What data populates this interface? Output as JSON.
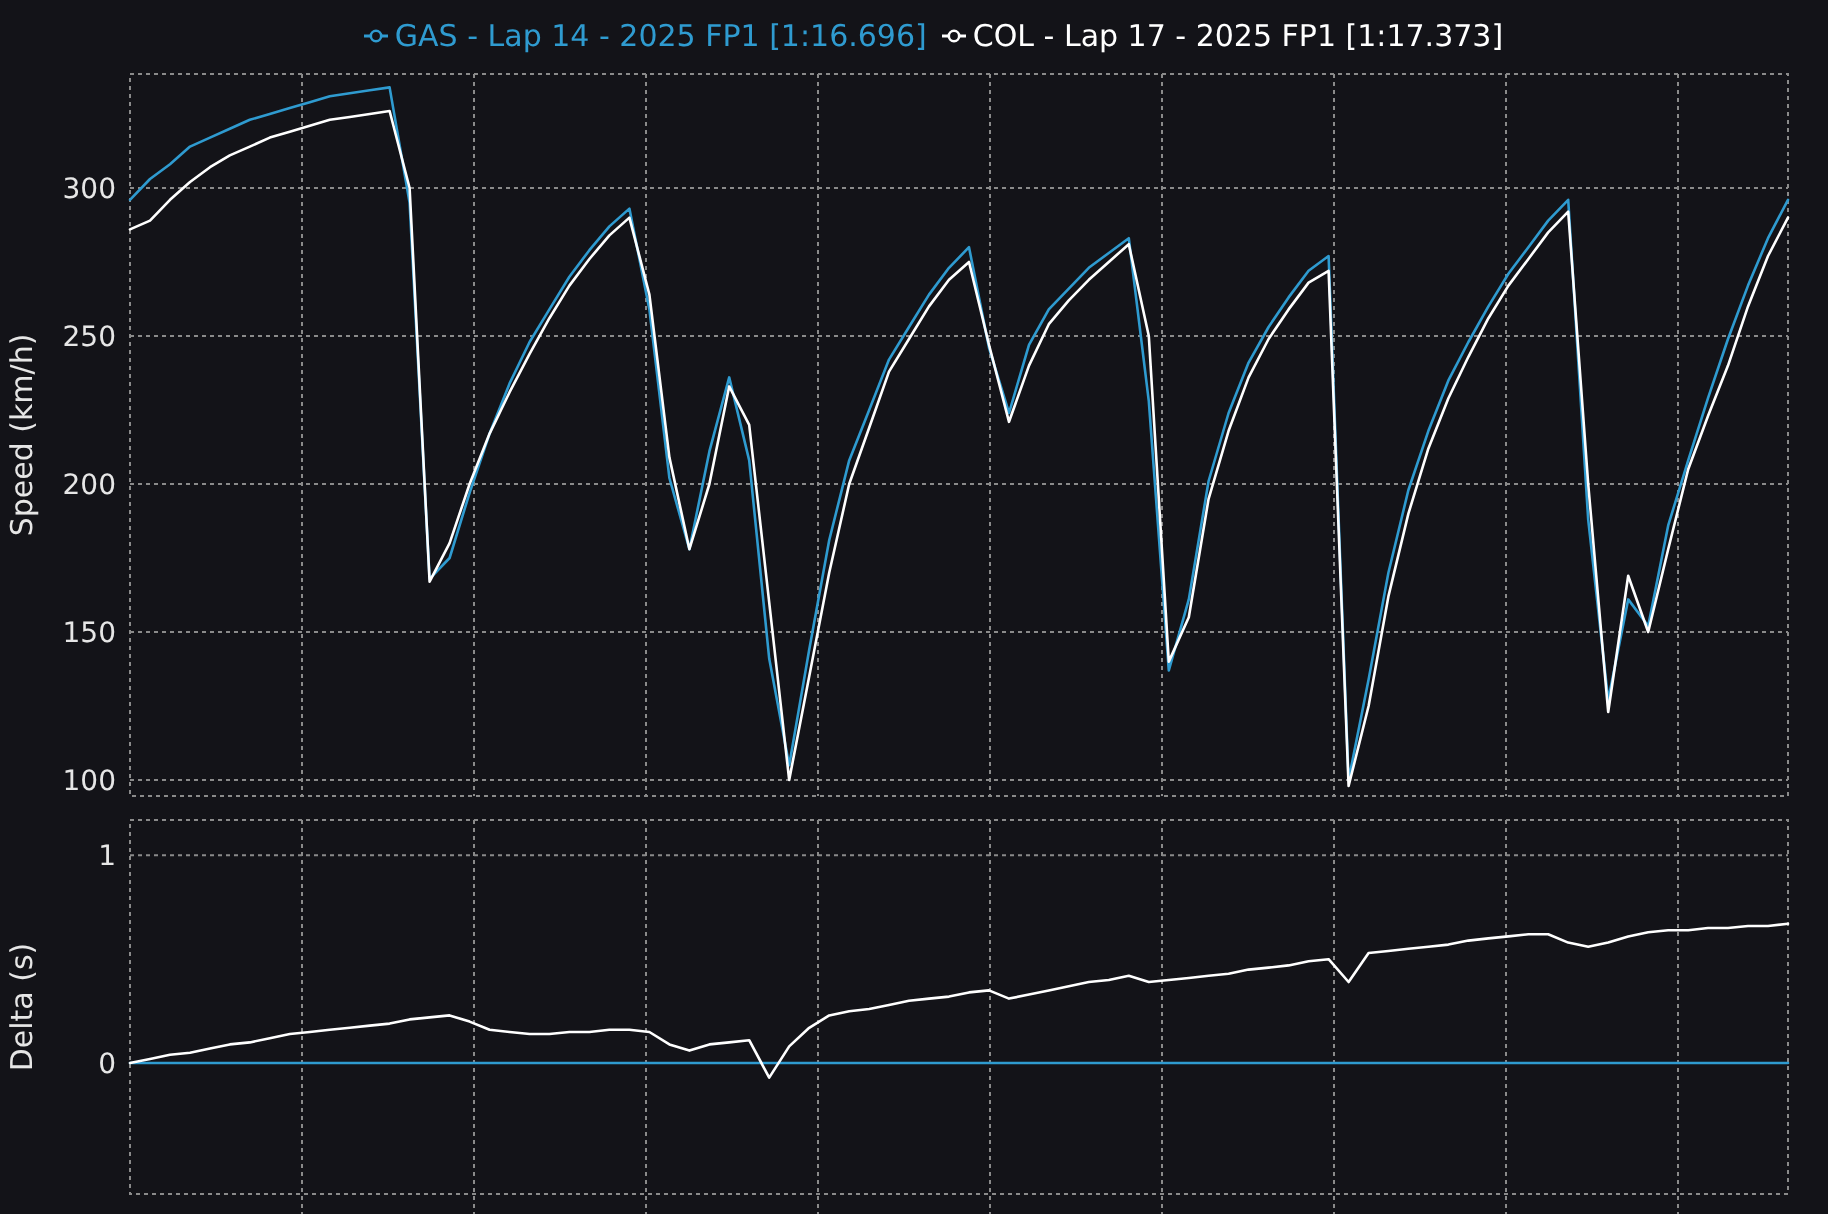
{
  "charts": [
    {
      "chart_data": {
        "type": "line",
        "grid": true,
        "ylabel": "Speed (km/h)",
        "ylim": [
          94.6,
          338.5
        ],
        "yticks": [
          100,
          150,
          200,
          250,
          300
        ],
        "categories": [
          null,
          null,
          null,
          null,
          null,
          null,
          null,
          null,
          null,
          null,
          null,
          null,
          null,
          null,
          null,
          null,
          null,
          null,
          null,
          null,
          null,
          null,
          null,
          null,
          null,
          null,
          null,
          null,
          null,
          null,
          null,
          null,
          null,
          null,
          null,
          null,
          null,
          null,
          null,
          null,
          null,
          null,
          null,
          null,
          null,
          null,
          null,
          null,
          null,
          null,
          null,
          null,
          null,
          null,
          null,
          null,
          null,
          null,
          null,
          null,
          null,
          null,
          null,
          null,
          null,
          null,
          null,
          null,
          null,
          null,
          null,
          null,
          null,
          null,
          null,
          null,
          null,
          null,
          null,
          null,
          null,
          null,
          null,
          null
        ],
        "series": [
          {
            "name": "GAS - Lap 14 - 2025 FP1 [1:16.696]",
            "color": "#2f9bd0",
            "values": [
              296,
              303,
              308,
              314,
              317,
              320,
              323,
              325,
              327,
              329,
              331,
              332,
              333,
              334,
              295,
              168,
              175,
              197,
              217,
              234,
              248,
              259,
              270,
              279,
              287,
              293,
              259,
              202,
              178,
              211,
              236,
              208,
              141,
              105,
              144,
              181,
              208,
              225,
              242,
              253,
              264,
              273,
              280,
              246,
              224,
              247,
              259,
              266,
              273,
              278,
              283,
              228,
              137,
              161,
              201,
              224,
              241,
              253,
              263,
              272,
              277,
              100,
              134,
              170,
              198,
              218,
              235,
              248,
              260,
              271,
              280,
              289,
              296,
              188,
              127,
              161,
              152,
              186,
              208,
              229,
              249,
              267,
              283,
              296
            ]
          },
          {
            "name": "COL - Lap 17 - 2025 FP1 [1:17.373]",
            "color": "#ffffff",
            "values": [
              286,
              289,
              296,
              302,
              307,
              311,
              314,
              317,
              319,
              321,
              323,
              324,
              325,
              326,
              300,
              167,
              180,
              200,
              217,
              231,
              244,
              256,
              267,
              276,
              284,
              290,
              264,
              209,
              178,
              200,
              233,
              220,
              160,
              100,
              135,
              170,
              200,
              219,
              238,
              249,
              260,
              269,
              275,
              247,
              221,
              240,
              254,
              262,
              269,
              275,
              281,
              250,
              140,
              155,
              195,
              218,
              236,
              249,
              259,
              268,
              272,
              98,
              125,
              162,
              190,
              212,
              229,
              243,
              256,
              267,
              276,
              285,
              292,
              200,
              123,
              169,
              150,
              178,
              205,
              223,
              240,
              260,
              277,
              290
            ]
          }
        ]
      }
    },
    {
      "chart_data": {
        "type": "line",
        "grid": true,
        "ylabel": "Delta (s)",
        "ylim": [
          -0.63,
          1.17
        ],
        "yticks": [
          0,
          1
        ],
        "categories": [
          null,
          null,
          null,
          null,
          null,
          null,
          null,
          null,
          null,
          null,
          null,
          null,
          null,
          null,
          null,
          null,
          null,
          null,
          null,
          null,
          null,
          null,
          null,
          null,
          null,
          null,
          null,
          null,
          null,
          null,
          null,
          null,
          null,
          null,
          null,
          null,
          null,
          null,
          null,
          null,
          null,
          null,
          null,
          null,
          null,
          null,
          null,
          null,
          null,
          null,
          null,
          null,
          null,
          null,
          null,
          null,
          null,
          null,
          null,
          null,
          null,
          null,
          null,
          null,
          null,
          null,
          null,
          null,
          null,
          null,
          null,
          null,
          null,
          null,
          null,
          null,
          null,
          null,
          null,
          null,
          null,
          null,
          null,
          null
        ],
        "series": [
          {
            "color": "#2f9bd0",
            "values": [
              0,
              0,
              0,
              0,
              0,
              0,
              0,
              0,
              0,
              0,
              0,
              0,
              0,
              0,
              0,
              0,
              0,
              0,
              0,
              0,
              0,
              0,
              0,
              0,
              0,
              0,
              0,
              0,
              0,
              0,
              0,
              0,
              0,
              0,
              0,
              0,
              0,
              0,
              0,
              0,
              0,
              0,
              0,
              0,
              0,
              0,
              0,
              0,
              0,
              0,
              0,
              0,
              0,
              0,
              0,
              0,
              0,
              0,
              0,
              0,
              0,
              0,
              0,
              0,
              0,
              0,
              0,
              0,
              0,
              0,
              0,
              0,
              0,
              0,
              0,
              0,
              0,
              0,
              0,
              0,
              0,
              0,
              0,
              0
            ]
          },
          {
            "color": "#ffffff",
            "values": [
              0,
              0.02,
              0.04,
              0.05,
              0.07,
              0.09,
              0.1,
              0.12,
              0.14,
              0.15,
              0.16,
              0.17,
              0.18,
              0.19,
              0.21,
              0.22,
              0.23,
              0.2,
              0.16,
              0.15,
              0.14,
              0.14,
              0.15,
              0.15,
              0.16,
              0.16,
              0.15,
              0.09,
              0.06,
              0.09,
              0.1,
              0.11,
              -0.07,
              0.08,
              0.17,
              0.23,
              0.25,
              0.26,
              0.28,
              0.3,
              0.31,
              0.32,
              0.34,
              0.35,
              0.31,
              0.33,
              0.35,
              0.37,
              0.39,
              0.4,
              0.42,
              0.39,
              0.4,
              0.41,
              0.42,
              0.43,
              0.45,
              0.46,
              0.47,
              0.49,
              0.5,
              0.39,
              0.53,
              0.54,
              0.55,
              0.56,
              0.57,
              0.59,
              0.6,
              0.61,
              0.62,
              0.62,
              0.58,
              0.56,
              0.58,
              0.61,
              0.63,
              0.64,
              0.64,
              0.65,
              0.65,
              0.66,
              0.66,
              0.67
            ]
          }
        ]
      }
    }
  ]
}
